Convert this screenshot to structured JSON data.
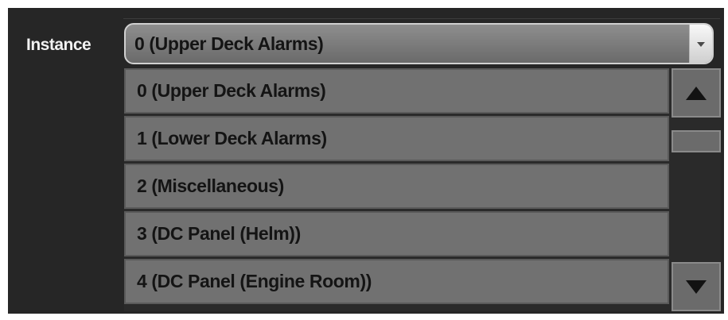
{
  "instance": {
    "label": "Instance",
    "selected_value": "0 (Upper Deck Alarms)"
  },
  "dropdown": {
    "options": [
      {
        "label": "0 (Upper Deck Alarms)"
      },
      {
        "label": "1 (Lower Deck Alarms)"
      },
      {
        "label": "2 (Miscellaneous)"
      },
      {
        "label": "3 (DC Panel (Helm))"
      },
      {
        "label": "4 (DC Panel (Engine Room))"
      }
    ]
  },
  "icons": {
    "select_arrow": "chevron-down-icon",
    "scroll_up": "triangle-up-icon",
    "scroll_down": "triangle-down-icon"
  },
  "colors": {
    "background": "#262626",
    "option_fill": "#717171",
    "text": "#141414",
    "label_text": "#f2f2f2"
  }
}
